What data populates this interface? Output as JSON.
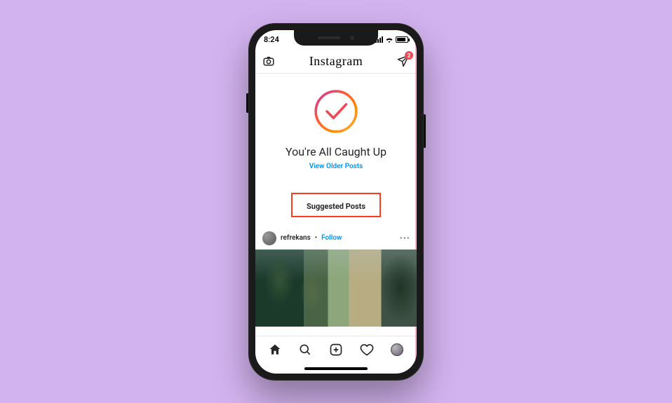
{
  "status": {
    "time": "8:24"
  },
  "header": {
    "brand": "Instagram",
    "dm_badge_count": "2"
  },
  "feed": {
    "caught_up_title": "You're All Caught Up",
    "older_link_label": "View Older Posts",
    "suggested_label": "Suggested Posts"
  },
  "post": {
    "username": "refrekans",
    "separator": "•",
    "follow_label": "Follow"
  }
}
